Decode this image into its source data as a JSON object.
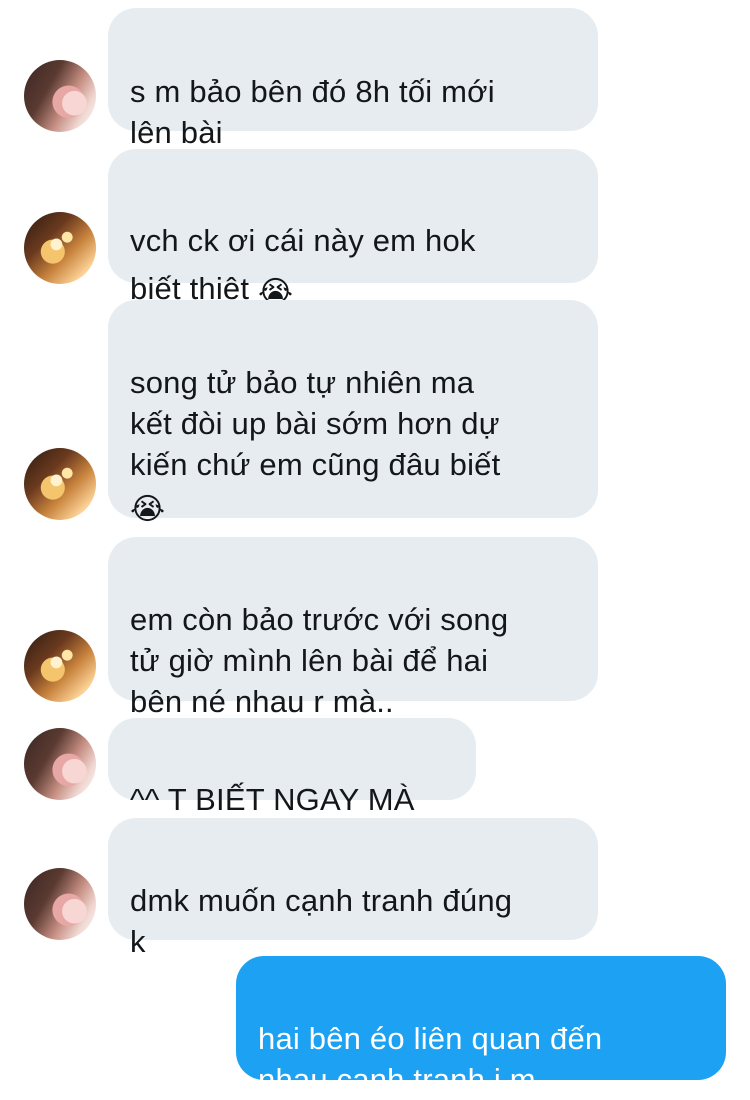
{
  "conversation": {
    "messages": [
      {
        "direction": "received",
        "text": "s m bảo bên đó 8h tối mới\nlên bài"
      },
      {
        "direction": "received",
        "text": "vch ck ơi cái này em hok\nbiết thiệt",
        "emoji": "😭"
      },
      {
        "direction": "received",
        "text": "song tử bảo tự nhiên ma\nkết đòi up bài sớm hơn dự\nkiến chứ em cũng đâu biết\n",
        "emoji": "😭"
      },
      {
        "direction": "received",
        "text": "em còn bảo trước với song\ntử giờ mình lên bài để hai\nbên né nhau r mà.."
      },
      {
        "direction": "received",
        "text": "^^ T BIẾT NGAY MÀ"
      },
      {
        "direction": "received",
        "text": "dmk muốn cạnh tranh đúng\nk"
      },
      {
        "direction": "sent",
        "text": "hai bên éo liên quan đến\nnhau cạnh tranh j m.."
      }
    ]
  },
  "colors": {
    "received_bubble": "#e6ecf0",
    "received_text": "#14171a",
    "sent_bubble": "#1da1f2",
    "sent_text": "#ffffff",
    "background": "#ffffff"
  },
  "icons": {
    "emoji_cry": "loudly-crying-face-emoji"
  }
}
